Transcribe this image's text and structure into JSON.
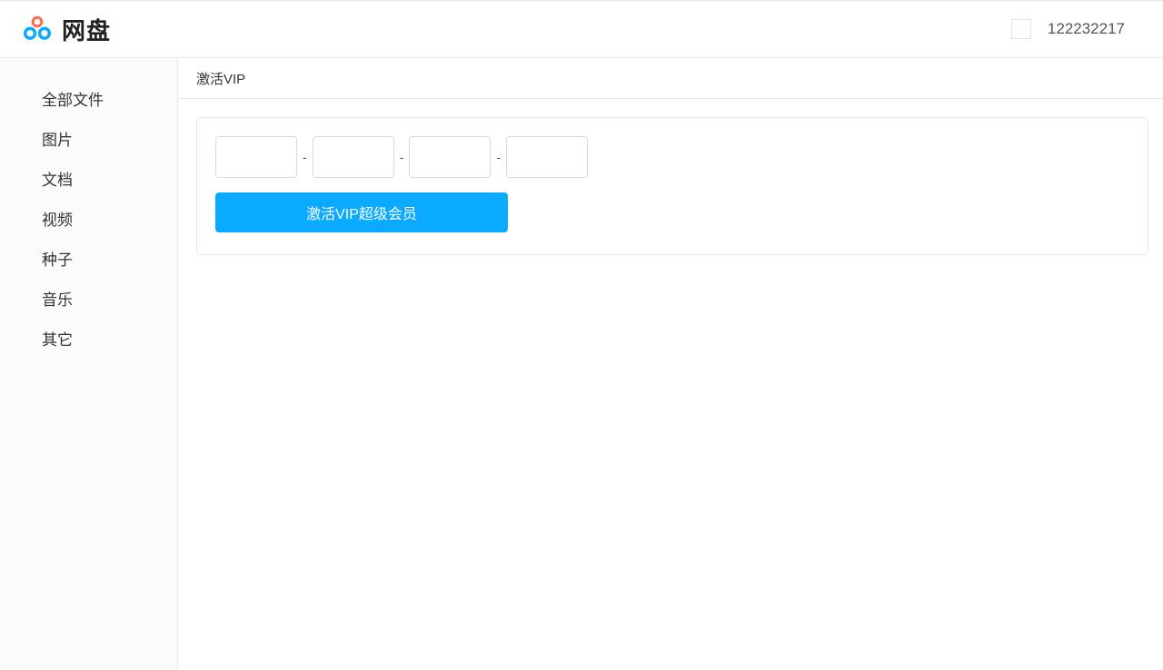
{
  "header": {
    "brand": "网盘",
    "user_id": "122232217"
  },
  "sidebar": {
    "items": [
      {
        "label": "全部文件"
      },
      {
        "label": "图片"
      },
      {
        "label": "文档"
      },
      {
        "label": "视频"
      },
      {
        "label": "种子"
      },
      {
        "label": "音乐"
      },
      {
        "label": "其它"
      }
    ]
  },
  "main": {
    "page_title": "激活VIP",
    "code_separator": "-",
    "code_inputs": [
      {
        "value": ""
      },
      {
        "value": ""
      },
      {
        "value": ""
      },
      {
        "value": ""
      }
    ],
    "activate_button_label": "激活VIP超级会员"
  }
}
